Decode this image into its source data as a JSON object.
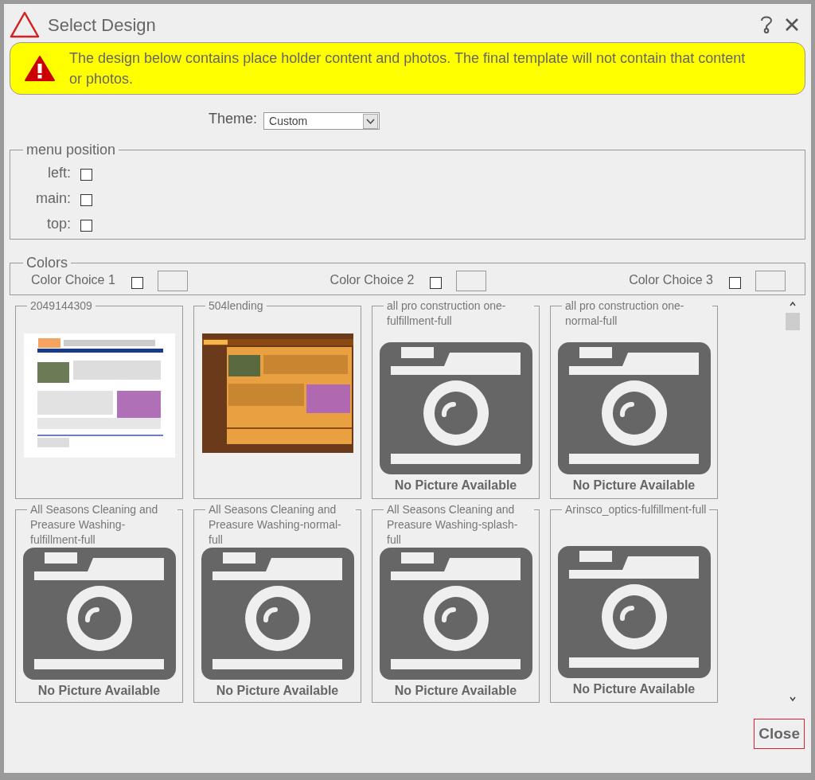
{
  "window": {
    "title": "Select Design"
  },
  "banner": {
    "message": "The design below contains place holder content and photos. The final template will not contain that content or photos."
  },
  "theme": {
    "label": "Theme:",
    "value": "Custom"
  },
  "menu_position": {
    "legend": "menu position",
    "options": [
      {
        "label": "left:",
        "checked": false
      },
      {
        "label": "main:",
        "checked": false
      },
      {
        "label": "top:",
        "checked": false
      }
    ]
  },
  "colors": {
    "legend": "Colors",
    "choices": [
      {
        "label": "Color Choice 1",
        "checked": false
      },
      {
        "label": "Color Choice 2",
        "checked": false
      },
      {
        "label": "Color Choice 3",
        "checked": false
      }
    ]
  },
  "designs": [
    {
      "name": "2049144309",
      "kind": "preview"
    },
    {
      "name": "504lending",
      "kind": "preview"
    },
    {
      "name": "all pro construction one-fulfillment-full",
      "kind": "placeholder",
      "caption": "No Picture Available"
    },
    {
      "name": "all pro construction one-normal-full",
      "kind": "placeholder",
      "caption": "No Picture Available"
    },
    {
      "name": "All Seasons Cleaning and Preasure Washing-fulfillment-full",
      "kind": "placeholder",
      "caption": "No Picture Available"
    },
    {
      "name": "All Seasons Cleaning and Preasure Washing-normal-full",
      "kind": "placeholder",
      "caption": "No Picture Available"
    },
    {
      "name": "All Seasons Cleaning and Preasure Washing-splash-full",
      "kind": "placeholder",
      "caption": "No Picture Available"
    },
    {
      "name": "Arinsco_optics-fulfillment-full",
      "kind": "placeholder",
      "caption": "No Picture Available"
    }
  ],
  "buttons": [
    {
      "label": "Close"
    }
  ]
}
